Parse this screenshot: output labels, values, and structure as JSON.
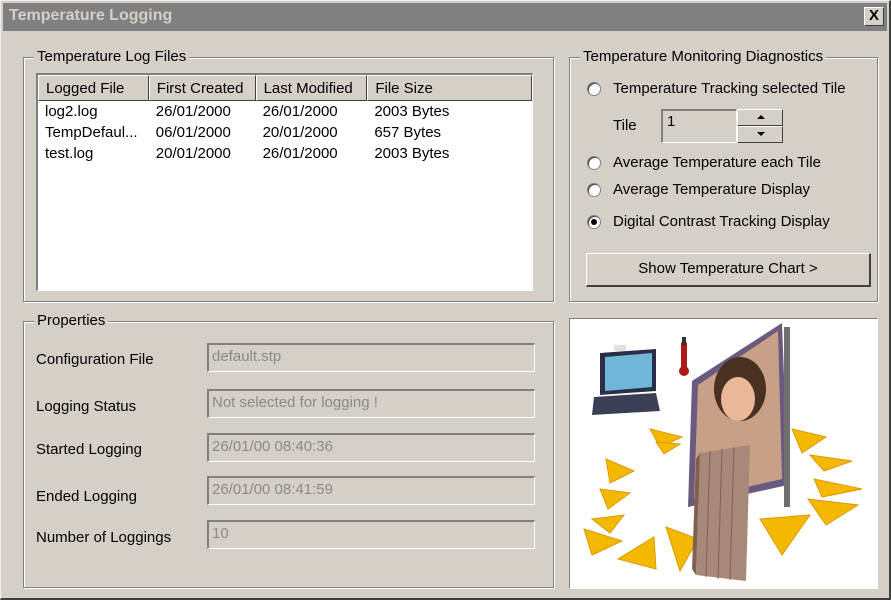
{
  "window": {
    "title": "Temperature Logging",
    "close_label": "X"
  },
  "log_files": {
    "group_title": "Temperature Log Files",
    "columns": [
      "Logged File",
      "First Created",
      "Last Modified",
      "File Size"
    ],
    "rows": [
      [
        "log2.log",
        "26/01/2000",
        "26/01/2000",
        "2003 Bytes"
      ],
      [
        "TempDefaul...",
        "06/01/2000",
        "20/01/2000",
        "657 Bytes"
      ],
      [
        "test.log",
        "20/01/2000",
        "26/01/2000",
        "2003 Bytes"
      ]
    ]
  },
  "diagnostics": {
    "group_title": "Temperature Monitoring Diagnostics",
    "options": [
      {
        "label": "Temperature Tracking selected Tile",
        "selected": false
      },
      {
        "label": "Average Temperature each Tile",
        "selected": false
      },
      {
        "label": "Average Temperature Display",
        "selected": false
      },
      {
        "label": "Digital Contrast Tracking Display",
        "selected": true
      }
    ],
    "tile_label": "Tile",
    "tile_value": "1",
    "chart_button": "Show Temperature Chart >"
  },
  "properties": {
    "group_title": "Properties",
    "configuration_file": {
      "label": "Configuration File",
      "value": "default.stp"
    },
    "logging_status": {
      "label": "Logging Status",
      "value": "Not selected for logging !"
    },
    "started_logging": {
      "label": "Started Logging",
      "value": "26/01/00  08:40:36"
    },
    "ended_logging": {
      "label": "Ended Logging",
      "value": "26/01/00  08:41:59"
    },
    "number_of_loggings": {
      "label": "Number of Loggings",
      "value": "10"
    }
  },
  "illustration": {
    "icons": [
      "laptop-icon",
      "thermometer-icon",
      "display-screen-icon",
      "led-tile-icon"
    ],
    "colors": {
      "arrow": "#f5b800",
      "thermometer": "#b01818",
      "screen_frame": "#6a5a80"
    }
  }
}
